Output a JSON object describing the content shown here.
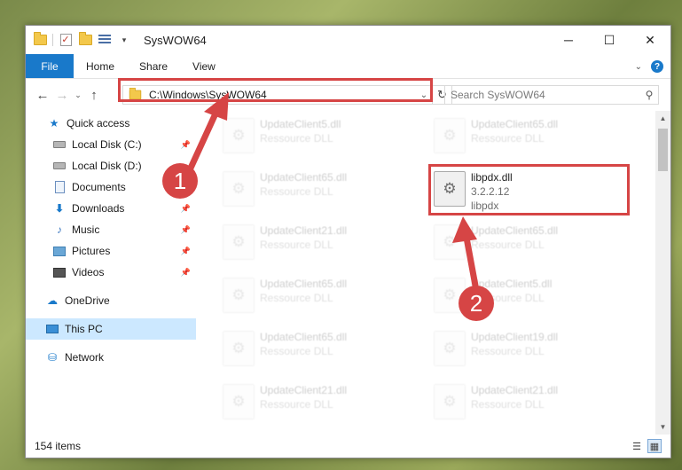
{
  "window": {
    "title": "SysWOW64",
    "controls": {
      "minimize": "─",
      "maximize": "☐",
      "close": "✕"
    }
  },
  "ribbon": {
    "file_tab": "File",
    "tabs": [
      "Home",
      "Share",
      "View"
    ],
    "expand_glyph": "⌄",
    "help_glyph": "?"
  },
  "nav": {
    "back_glyph": "←",
    "forward_glyph": "→",
    "recent_glyph": "⌄",
    "up_glyph": "↑",
    "address": "C:\\Windows\\SysWOW64",
    "address_dropdown_glyph": "⌄",
    "refresh_glyph": "↻",
    "search_placeholder": "Search SysWOW64",
    "search_glyph": "⚲"
  },
  "sidebar": {
    "items": [
      {
        "label": "Quick access",
        "icon": "star-icon",
        "glyph": "★"
      },
      {
        "label": "Local Disk (C:)",
        "icon": "drive-icon",
        "pinned": true
      },
      {
        "label": "Local Disk (D:)",
        "icon": "drive-icon",
        "pinned": false
      },
      {
        "label": "Documents",
        "icon": "document-icon",
        "pinned": true
      },
      {
        "label": "Downloads",
        "icon": "download-icon",
        "glyph": "⬇",
        "pinned": true
      },
      {
        "label": "Music",
        "icon": "music-icon",
        "glyph": "♪",
        "pinned": true
      },
      {
        "label": "Pictures",
        "icon": "pictures-icon",
        "pinned": true
      },
      {
        "label": "Videos",
        "icon": "videos-icon",
        "pinned": true
      },
      {
        "label": "OneDrive",
        "icon": "cloud-icon",
        "glyph": "☁"
      },
      {
        "label": "This PC",
        "icon": "computer-icon",
        "selected": true
      },
      {
        "label": "Network",
        "icon": "network-icon",
        "glyph": "⛁"
      }
    ],
    "pin_glyph": "📌"
  },
  "files": [
    {
      "name": "UpdateClient5.dll",
      "type": "Ressource DLL",
      "faded": true
    },
    {
      "name": "UpdateClient65.dll",
      "type": "Ressource DLL",
      "faded": true
    },
    {
      "name": "UpdateClient65.dll",
      "type": "Ressource DLL",
      "faded": true
    },
    {
      "name": "libpdx.dll",
      "version": "3.2.2.12",
      "type": "libpdx",
      "faded": false
    },
    {
      "name": "UpdateClient21.dll",
      "type": "Ressource DLL",
      "faded": true
    },
    {
      "name": "UpdateClient65.dll",
      "type": "Ressource DLL",
      "faded": true
    },
    {
      "name": "UpdateClient65.dll",
      "type": "Ressource DLL",
      "faded": true
    },
    {
      "name": "UpdateClient5.dll",
      "type": "Ressource DLL",
      "faded": true
    },
    {
      "name": "UpdateClient65.dll",
      "type": "Ressource DLL",
      "faded": true
    },
    {
      "name": "UpdateClient19.dll",
      "type": "Ressource DLL",
      "faded": true
    },
    {
      "name": "UpdateClient21.dll",
      "type": "Ressource DLL",
      "faded": true
    },
    {
      "name": "UpdateClient21.dll",
      "type": "Ressource DLL",
      "faded": true
    }
  ],
  "file_icon_glyph": "⚙",
  "scrollbar": {
    "up_glyph": "▲",
    "down_glyph": "▼"
  },
  "status": {
    "item_count": "154 items",
    "details_view_glyph": "☰",
    "tiles_view_glyph": "▦"
  },
  "annotations": {
    "step1": "1",
    "step2": "2",
    "color": "#d64545"
  }
}
